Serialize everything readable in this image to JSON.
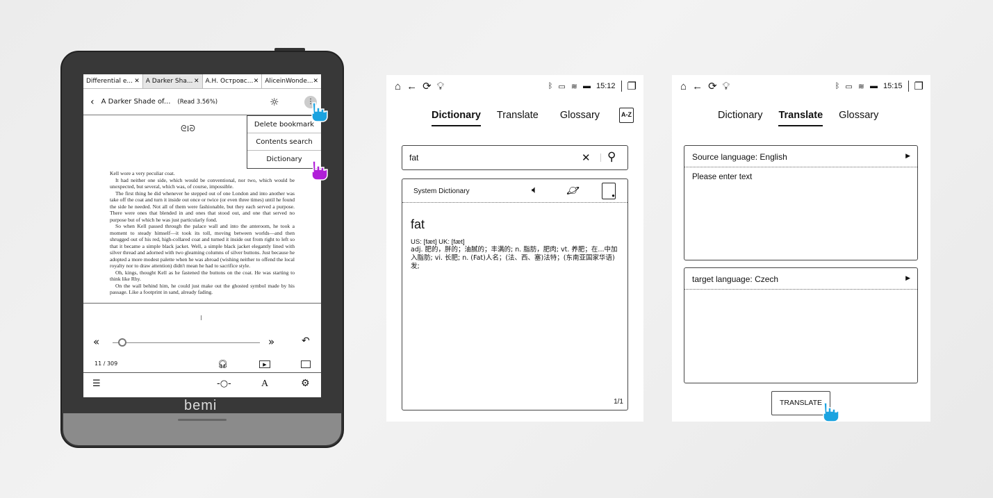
{
  "reader": {
    "brand": "bemi",
    "tabs": [
      {
        "label": "Differential e...",
        "active": false
      },
      {
        "label": "A Darker Sha...",
        "active": true
      },
      {
        "label": "А.Н. Островс...",
        "active": false
      },
      {
        "label": "AliceinWonde...",
        "active": false
      }
    ],
    "tab_close": "✕",
    "book_title": "A Darker Shade of...",
    "read_progress": "(Read 3.56%)",
    "menu": [
      "Delete bookmark",
      "Contents search",
      "Dictionary"
    ],
    "chapter_ornament": "I",
    "paragraphs": [
      "Kell wore a very peculiar coat.",
      "It had neither one side, which would be conventional, nor two, which would be unexpected, but several, which was, of course, impossible.",
      "The first thing he did whenever he stepped out of one London and into another was take off the coat and turn it inside out once or twice (or even three times) until he found the side he needed. Not all of them were fashionable, but they each served a purpose. There were ones that blended in and ones that stood out, and one that served no purpose but of which he was just particularly fond.",
      "So when Kell passed through the palace wall and into the anteroom, he took a moment to steady himself—it took its toll, moving between worlds—and then shrugged out of his red, high-collared coat and turned it inside out from right to left so that it became a simple black jacket. Well, a simple black jacket elegantly lined with silver thread and adorned with two gleaming columns of silver buttons. Just because he adopted a more modest palette when he was abroad (wishing neither to offend the local royalty nor to draw attention) didn't mean he had to sacrifice style.",
      "Oh, kings, thought Kell as he fastened the buttons on the coat. He was starting to think like Rhy.",
      "On the wall behind him, he could just make out the ghosted symbol made by his passage. Like a footprint in sand, already fading."
    ],
    "page_marker": "I",
    "page_indicator": "11 / 309",
    "slider_progress": 0.0356
  },
  "dictionary_panel": {
    "time": "15:12",
    "tabs": [
      "Dictionary",
      "Translate",
      "Glossary"
    ],
    "active_tab": "Dictionary",
    "az_label": "A-Z",
    "search_value": "fat",
    "source_name": "System Dictionary",
    "headword": "fat",
    "pronunciation": "US: [fæt] UK: [fæt]",
    "definition": "adj. 肥的，胖的；油腻的；丰满的; n. 脂肪，肥肉; vt. 养肥；在...中加入脂肪; vi. 长肥; n. (Fat)人名；(法、西、塞)法特；(东南亚国家华语)发;",
    "page": "1/1"
  },
  "translate_panel": {
    "time": "15:15",
    "tabs": [
      "Dictionary",
      "Translate",
      "Glossary"
    ],
    "active_tab": "Translate",
    "source_language": "Source language: English",
    "source_placeholder": "Please enter text",
    "target_language": "target language: Czech",
    "translate_button": "TRANSLATE"
  },
  "colors": {
    "hand_blue": "#1ba3e0",
    "hand_purple": "#b01fd8",
    "device_frame": "#383838"
  }
}
